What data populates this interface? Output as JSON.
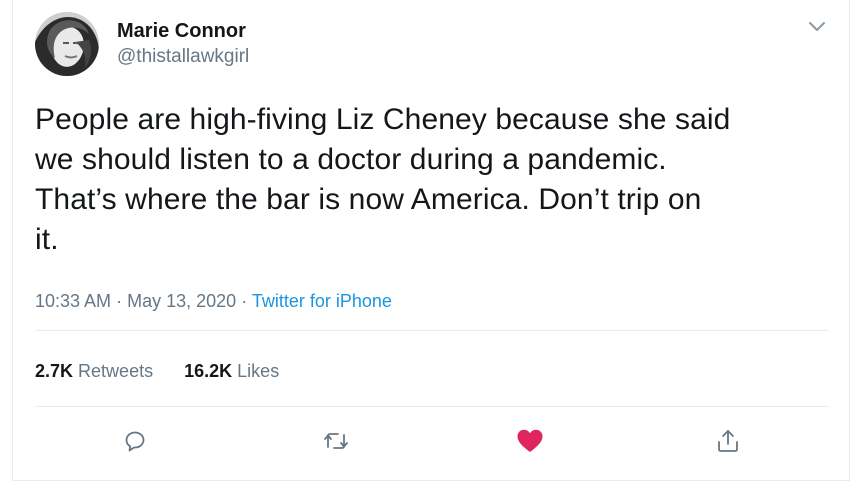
{
  "user": {
    "name": "Marie Connor",
    "handle": "@thistallawkgirl"
  },
  "tweet": {
    "text_lines": [
      "People are high-fiving Liz Cheney because she said",
      "we should listen to a doctor during a pandemic.",
      "That’s where the bar is now America. Don’t trip on",
      "it."
    ],
    "time": "10:33 AM",
    "separator": "·",
    "date": "May 13, 2020",
    "source": "Twitter for iPhone"
  },
  "stats": {
    "retweets_count": "2.7K",
    "retweets_label": "Retweets",
    "likes_count": "16.2K",
    "likes_label": "Likes"
  },
  "actions": [
    {
      "icon": "reply-icon"
    },
    {
      "icon": "retweet-icon"
    },
    {
      "icon": "heart-icon",
      "active": true
    },
    {
      "icon": "share-icon"
    }
  ],
  "colors": {
    "accent": "#1b95e0",
    "like": "#e0245e",
    "secondary_text": "#657786",
    "primary_text": "#14171a",
    "divider": "#e6ecf0"
  }
}
